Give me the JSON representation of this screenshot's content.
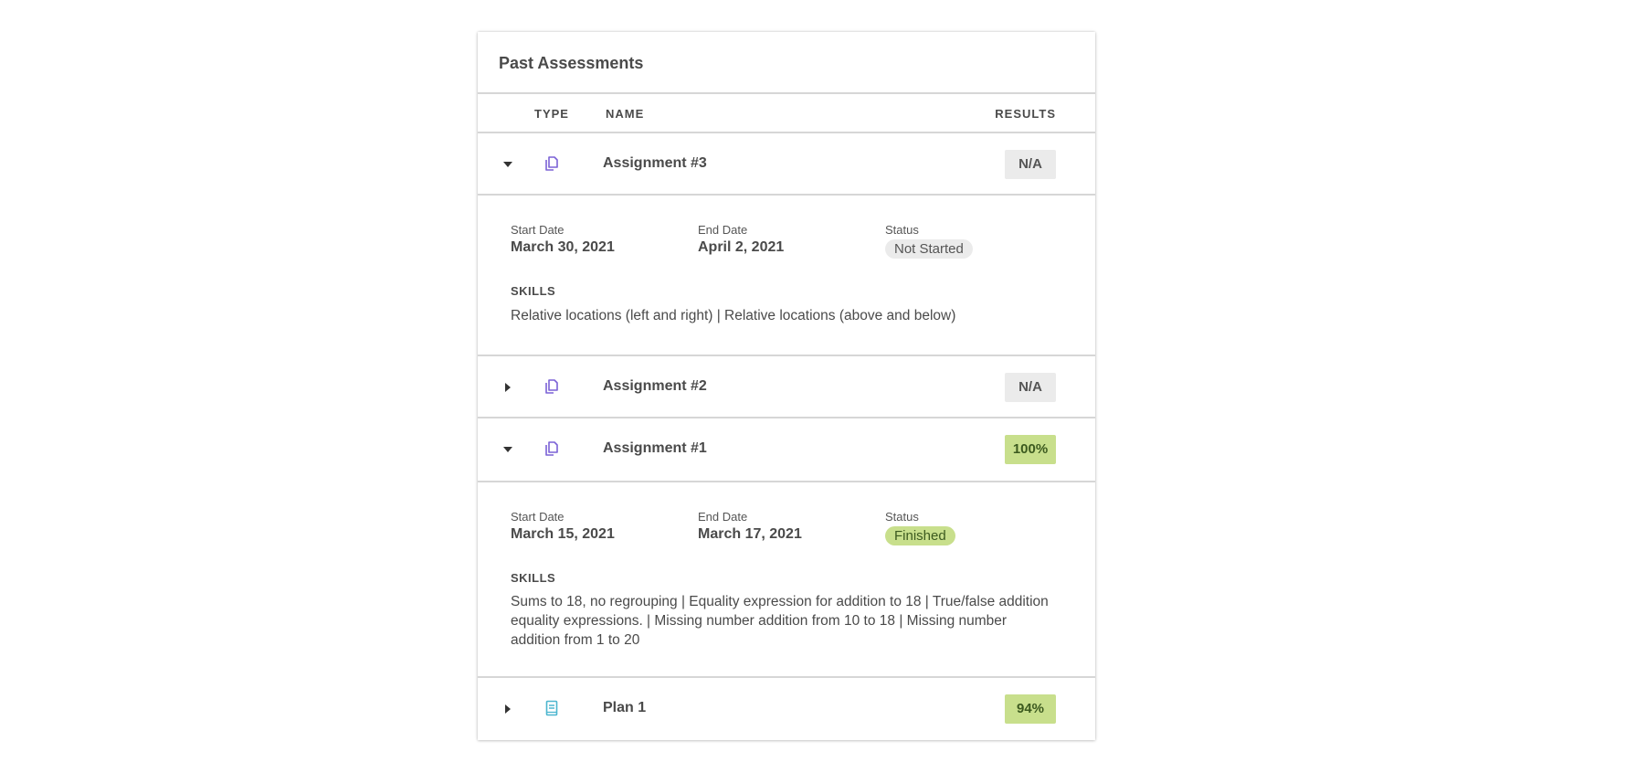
{
  "card": {
    "title": "Past Assessments",
    "columns": {
      "type": "TYPE",
      "name": "NAME",
      "results": "RESULTS"
    }
  },
  "colors": {
    "assignment_icon": "#7b62d6",
    "plan_icon": "#4cb6cf",
    "badge_na_bg": "#ebebeb",
    "badge_na_text": "#555555",
    "badge_pass_bg": "#c8df8c",
    "badge_pass_text": "#3c5a1f"
  },
  "rows": [
    {
      "type_icon": "copy-icon",
      "name": "Assignment #3",
      "result": "N/A",
      "expanded": true,
      "details": {
        "start_label": "Start Date",
        "start": "March 30, 2021",
        "end_label": "End Date",
        "end": "April 2, 2021",
        "status_label": "Status",
        "status": "Not Started",
        "skills_label": "SKILLS",
        "skills": "Relative locations (left and right) | Relative locations (above and below)"
      }
    },
    {
      "type_icon": "copy-icon",
      "name": "Assignment #2",
      "result": "N/A",
      "expanded": false
    },
    {
      "type_icon": "copy-icon",
      "name": "Assignment #1",
      "result": "100%",
      "expanded": true,
      "details": {
        "start_label": "Start Date",
        "start": "March 15, 2021",
        "end_label": "End Date",
        "end": "March 17, 2021",
        "status_label": "Status",
        "status": "Finished",
        "skills_label": "SKILLS",
        "skills": "Sums to 18, no regrouping | Equality expression for addition to 18 | True/false addition equality expressions. | Missing number addition from 10 to 18 | Missing number addition from 1 to 20"
      }
    },
    {
      "type_icon": "book-icon",
      "name": "Plan 1",
      "result": "94%",
      "expanded": false
    }
  ]
}
